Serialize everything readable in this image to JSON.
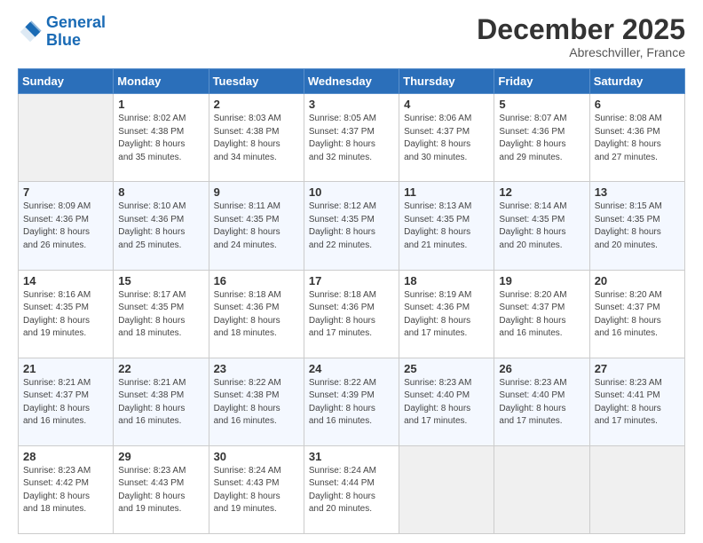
{
  "logo": {
    "line1": "General",
    "line2": "Blue"
  },
  "header": {
    "month": "December 2025",
    "location": "Abreschviller, France"
  },
  "weekdays": [
    "Sunday",
    "Monday",
    "Tuesday",
    "Wednesday",
    "Thursday",
    "Friday",
    "Saturday"
  ],
  "weeks": [
    [
      {
        "day": "",
        "empty": true
      },
      {
        "day": "1",
        "sunrise": "8:02 AM",
        "sunset": "4:38 PM",
        "daylight": "8 hours and 35 minutes."
      },
      {
        "day": "2",
        "sunrise": "8:03 AM",
        "sunset": "4:38 PM",
        "daylight": "8 hours and 34 minutes."
      },
      {
        "day": "3",
        "sunrise": "8:05 AM",
        "sunset": "4:37 PM",
        "daylight": "8 hours and 32 minutes."
      },
      {
        "day": "4",
        "sunrise": "8:06 AM",
        "sunset": "4:37 PM",
        "daylight": "8 hours and 30 minutes."
      },
      {
        "day": "5",
        "sunrise": "8:07 AM",
        "sunset": "4:36 PM",
        "daylight": "8 hours and 29 minutes."
      },
      {
        "day": "6",
        "sunrise": "8:08 AM",
        "sunset": "4:36 PM",
        "daylight": "8 hours and 27 minutes."
      }
    ],
    [
      {
        "day": "7",
        "sunrise": "8:09 AM",
        "sunset": "4:36 PM",
        "daylight": "8 hours and 26 minutes."
      },
      {
        "day": "8",
        "sunrise": "8:10 AM",
        "sunset": "4:36 PM",
        "daylight": "8 hours and 25 minutes."
      },
      {
        "day": "9",
        "sunrise": "8:11 AM",
        "sunset": "4:35 PM",
        "daylight": "8 hours and 24 minutes."
      },
      {
        "day": "10",
        "sunrise": "8:12 AM",
        "sunset": "4:35 PM",
        "daylight": "8 hours and 22 minutes."
      },
      {
        "day": "11",
        "sunrise": "8:13 AM",
        "sunset": "4:35 PM",
        "daylight": "8 hours and 21 minutes."
      },
      {
        "day": "12",
        "sunrise": "8:14 AM",
        "sunset": "4:35 PM",
        "daylight": "8 hours and 20 minutes."
      },
      {
        "day": "13",
        "sunrise": "8:15 AM",
        "sunset": "4:35 PM",
        "daylight": "8 hours and 20 minutes."
      }
    ],
    [
      {
        "day": "14",
        "sunrise": "8:16 AM",
        "sunset": "4:35 PM",
        "daylight": "8 hours and 19 minutes."
      },
      {
        "day": "15",
        "sunrise": "8:17 AM",
        "sunset": "4:35 PM",
        "daylight": "8 hours and 18 minutes."
      },
      {
        "day": "16",
        "sunrise": "8:18 AM",
        "sunset": "4:36 PM",
        "daylight": "8 hours and 18 minutes."
      },
      {
        "day": "17",
        "sunrise": "8:18 AM",
        "sunset": "4:36 PM",
        "daylight": "8 hours and 17 minutes."
      },
      {
        "day": "18",
        "sunrise": "8:19 AM",
        "sunset": "4:36 PM",
        "daylight": "8 hours and 17 minutes."
      },
      {
        "day": "19",
        "sunrise": "8:20 AM",
        "sunset": "4:37 PM",
        "daylight": "8 hours and 16 minutes."
      },
      {
        "day": "20",
        "sunrise": "8:20 AM",
        "sunset": "4:37 PM",
        "daylight": "8 hours and 16 minutes."
      }
    ],
    [
      {
        "day": "21",
        "sunrise": "8:21 AM",
        "sunset": "4:37 PM",
        "daylight": "8 hours and 16 minutes."
      },
      {
        "day": "22",
        "sunrise": "8:21 AM",
        "sunset": "4:38 PM",
        "daylight": "8 hours and 16 minutes."
      },
      {
        "day": "23",
        "sunrise": "8:22 AM",
        "sunset": "4:38 PM",
        "daylight": "8 hours and 16 minutes."
      },
      {
        "day": "24",
        "sunrise": "8:22 AM",
        "sunset": "4:39 PM",
        "daylight": "8 hours and 16 minutes."
      },
      {
        "day": "25",
        "sunrise": "8:23 AM",
        "sunset": "4:40 PM",
        "daylight": "8 hours and 17 minutes."
      },
      {
        "day": "26",
        "sunrise": "8:23 AM",
        "sunset": "4:40 PM",
        "daylight": "8 hours and 17 minutes."
      },
      {
        "day": "27",
        "sunrise": "8:23 AM",
        "sunset": "4:41 PM",
        "daylight": "8 hours and 17 minutes."
      }
    ],
    [
      {
        "day": "28",
        "sunrise": "8:23 AM",
        "sunset": "4:42 PM",
        "daylight": "8 hours and 18 minutes."
      },
      {
        "day": "29",
        "sunrise": "8:23 AM",
        "sunset": "4:43 PM",
        "daylight": "8 hours and 19 minutes."
      },
      {
        "day": "30",
        "sunrise": "8:24 AM",
        "sunset": "4:43 PM",
        "daylight": "8 hours and 19 minutes."
      },
      {
        "day": "31",
        "sunrise": "8:24 AM",
        "sunset": "4:44 PM",
        "daylight": "8 hours and 20 minutes."
      },
      {
        "day": "",
        "empty": true
      },
      {
        "day": "",
        "empty": true
      },
      {
        "day": "",
        "empty": true
      }
    ]
  ],
  "labels": {
    "sunrise": "Sunrise: ",
    "sunset": "Sunset: ",
    "daylight": "Daylight: "
  }
}
